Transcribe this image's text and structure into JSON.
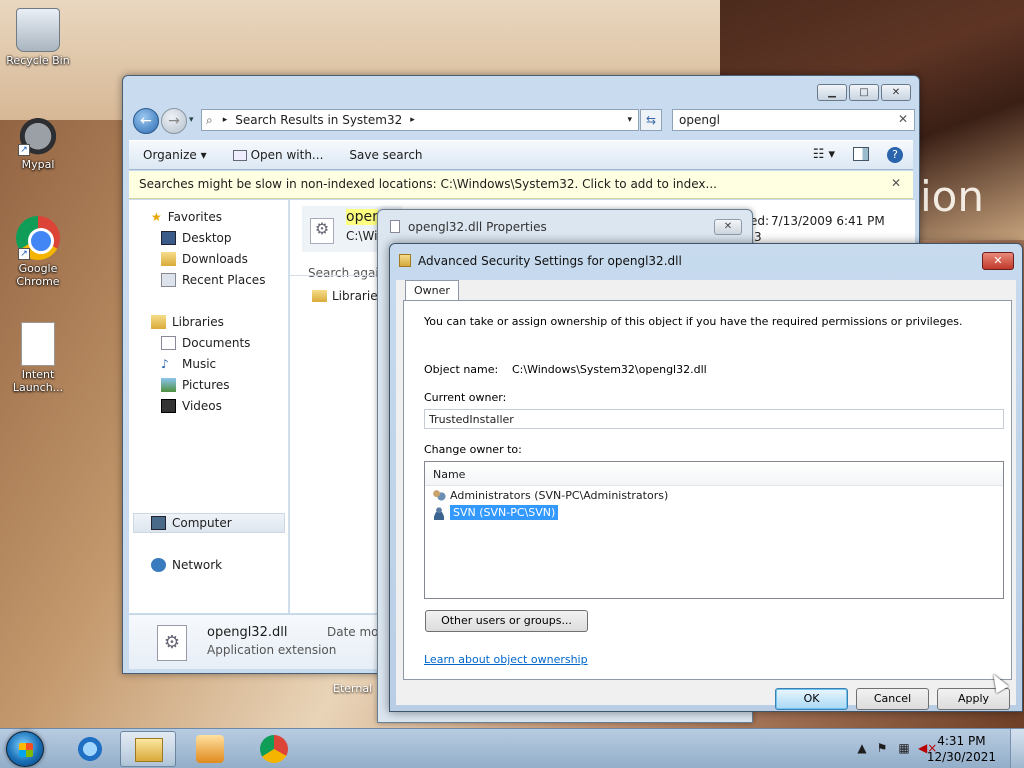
{
  "desktop": {
    "icons": [
      {
        "label": "Recycle Bin"
      },
      {
        "label": "Mypal"
      },
      {
        "label": "Google Chrome"
      },
      {
        "label": "Intent Launch..."
      }
    ],
    "background_text": "ion",
    "hidden_label": "Eternal"
  },
  "explorer": {
    "breadcrumb": "Search Results in System32",
    "search_value": "opengl",
    "toolbar": {
      "organize": "Organize ▾",
      "open_with": "Open with...",
      "save_search": "Save search"
    },
    "infobar": "Searches might be slow in non-indexed locations: C:\\Windows\\System32. Click to add to index...",
    "nav": {
      "favorites": "Favorites",
      "desktop": "Desktop",
      "downloads": "Downloads",
      "recent": "Recent Places",
      "libraries": "Libraries",
      "documents": "Documents",
      "music": "Music",
      "pictures": "Pictures",
      "videos": "Videos",
      "computer": "Computer",
      "network": "Network"
    },
    "result": {
      "name_partial": "oper",
      "path_partial": "C:\\Wi",
      "date_modified": "7/13/2009 6:41 PM",
      "date_prefix": "ed:",
      "extra_digit": "3"
    },
    "search_again": "Search again",
    "search_again_libraries": "Libraries",
    "details": {
      "name": "opengl32.dll",
      "type": "Application extension",
      "date_label": "Date moc"
    }
  },
  "props_dialog": {
    "title": "opengl32.dll Properties"
  },
  "adv_dialog": {
    "title": "Advanced Security Settings for opengl32.dll",
    "tab": "Owner",
    "description": "You can take or assign ownership of this object if you have the required permissions or privileges.",
    "object_name_label": "Object name:",
    "object_name_value": "C:\\Windows\\System32\\opengl32.dll",
    "current_owner_label": "Current owner:",
    "current_owner_value": "TrustedInstaller",
    "change_owner_label": "Change owner to:",
    "list_header": "Name",
    "owners": [
      {
        "name": "Administrators (SVN-PC\\Administrators)",
        "selected": false
      },
      {
        "name": "SVN (SVN-PC\\SVN)",
        "selected": true
      }
    ],
    "other_users_button": "Other users or groups...",
    "learn_link": "Learn about object ownership",
    "ok": "OK",
    "cancel": "Cancel",
    "apply": "Apply"
  },
  "taskbar": {
    "time": "4:31 PM",
    "date": "12/30/2021"
  }
}
